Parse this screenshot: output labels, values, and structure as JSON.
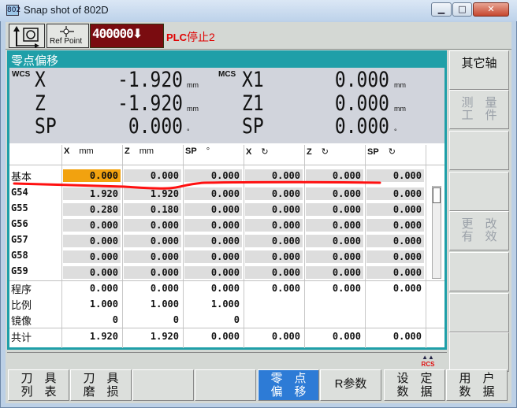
{
  "window": {
    "title": "Snap shot of 802D",
    "icon_label": "802",
    "minimize_icon": "minimize-icon",
    "maximize_icon": "maximize-icon",
    "close_icon": "close-icon"
  },
  "status_bar": {
    "mode_icon": "jog-mode-icon",
    "ref_point_label": "Ref Point",
    "program_number": "400000",
    "program_arrow": "⬇",
    "alarm_prefix": "PLC",
    "alarm_text": "停止2"
  },
  "panel": {
    "title": "零点偏移",
    "wcs_label": "WCS",
    "mcs_label": "MCS",
    "wcs": [
      {
        "axis": "X",
        "value": "-1.920",
        "unit": "mm"
      },
      {
        "axis": "Z",
        "value": "-1.920",
        "unit": "mm"
      },
      {
        "axis": "SP",
        "value": "0.000",
        "unit": "°"
      }
    ],
    "mcs": [
      {
        "axis": "X1",
        "value": "0.000",
        "unit": "mm"
      },
      {
        "axis": "Z1",
        "value": "0.000",
        "unit": "mm"
      },
      {
        "axis": "SP",
        "value": "0.000",
        "unit": "°"
      }
    ]
  },
  "table": {
    "columns": [
      {
        "axis": "X",
        "unit": "mm"
      },
      {
        "axis": "Z",
        "unit": "mm"
      },
      {
        "axis": "SP",
        "unit": "°"
      },
      {
        "axis": "X",
        "unit": "↻"
      },
      {
        "axis": "Z",
        "unit": "↻"
      },
      {
        "axis": "SP",
        "unit": "↻"
      }
    ],
    "rows": [
      {
        "label": "基本",
        "values": [
          "0.000",
          "0.000",
          "0.000",
          "0.000",
          "0.000",
          "0.000"
        ]
      },
      {
        "label": "G54",
        "values": [
          "1.920",
          "1.920",
          "0.000",
          "0.000",
          "0.000",
          "0.000"
        ]
      },
      {
        "label": "G55",
        "values": [
          "0.280",
          "0.180",
          "0.000",
          "0.000",
          "0.000",
          "0.000"
        ]
      },
      {
        "label": "G56",
        "values": [
          "0.000",
          "0.000",
          "0.000",
          "0.000",
          "0.000",
          "0.000"
        ]
      },
      {
        "label": "G57",
        "values": [
          "0.000",
          "0.000",
          "0.000",
          "0.000",
          "0.000",
          "0.000"
        ]
      },
      {
        "label": "G58",
        "values": [
          "0.000",
          "0.000",
          "0.000",
          "0.000",
          "0.000",
          "0.000"
        ]
      },
      {
        "label": "G59",
        "values": [
          "0.000",
          "0.000",
          "0.000",
          "0.000",
          "0.000",
          "0.000"
        ]
      },
      {
        "label": "程序",
        "values": [
          "0.000",
          "0.000",
          "0.000",
          "0.000",
          "0.000",
          "0.000"
        ]
      },
      {
        "label": "比例",
        "values": [
          "1.000",
          "1.000",
          "1.000",
          "",
          "",
          ""
        ]
      },
      {
        "label": "镜像",
        "values": [
          "0",
          "0",
          "0",
          "",
          "",
          ""
        ]
      },
      {
        "label": "共计",
        "values": [
          "1.920",
          "1.920",
          "0.000",
          "0.000",
          "0.000",
          "0.000"
        ]
      }
    ]
  },
  "right_softkeys": [
    {
      "line1": "其它轴",
      "line2": ""
    },
    {
      "line1": "测　量",
      "line2": "工　件"
    },
    {
      "line1": "",
      "line2": ""
    },
    {
      "line1": "",
      "line2": ""
    },
    {
      "line1": "更　改",
      "line2": "有　效"
    },
    {
      "line1": "",
      "line2": ""
    },
    {
      "line1": "",
      "line2": ""
    },
    {
      "line1": "",
      "line2": ""
    }
  ],
  "bottom_softkeys": [
    {
      "line1": "刀　具",
      "line2": "列　表"
    },
    {
      "line1": "刀　具",
      "line2": "磨　损"
    },
    {
      "line1": "",
      "line2": ""
    },
    {
      "line1": "",
      "line2": ""
    },
    {
      "line1": "零　点",
      "line2": "偏　移"
    },
    {
      "line1": "R参数",
      "line2": ""
    },
    {
      "line1": "设　定",
      "line2": "数　据"
    },
    {
      "line1": "用　户",
      "line2": "数　据"
    }
  ],
  "rcs_label": "RCS",
  "colors": {
    "panel_accent": "#1f9fa8",
    "active_key": "#2d7bd6",
    "highlight_cell": "#f2a20f",
    "alarm": "#e00000",
    "program_box": "#7a0c10"
  }
}
